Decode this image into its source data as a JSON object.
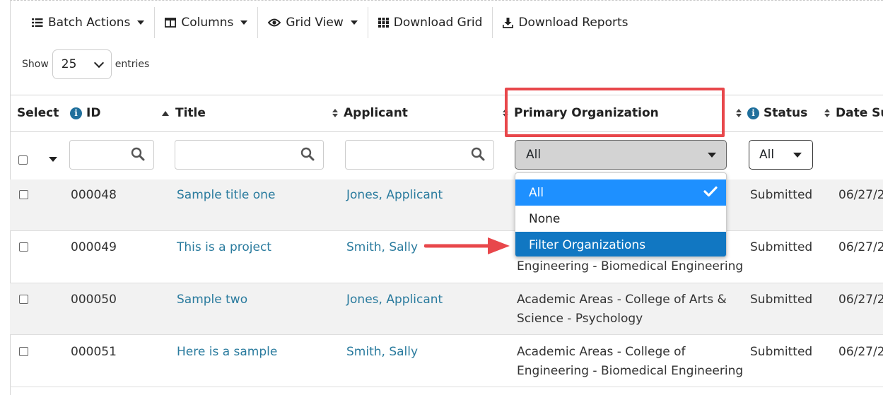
{
  "toolbar": {
    "batch_actions": "Batch Actions",
    "columns": "Columns",
    "grid_view": "Grid View",
    "download_grid": "Download Grid",
    "download_reports": "Download Reports"
  },
  "length": {
    "show": "Show",
    "value": "25",
    "entries": "entries"
  },
  "columns": {
    "select": "Select",
    "id": "ID",
    "title": "Title",
    "applicant": "Applicant",
    "primary_org": "Primary Organization",
    "status": "Status",
    "date_submitted": "Date Su"
  },
  "filters": {
    "org_value": "All",
    "status_value": "All"
  },
  "org_dropdown": {
    "options": [
      "All",
      "None",
      "Filter Organizations"
    ],
    "selected": "All",
    "highlighted": "Filter Organizations"
  },
  "rows": [
    {
      "id": "000048",
      "title": "Sample title one",
      "applicant": "Jones, Applicant",
      "org_line1": "",
      "org_line2": "",
      "status": "Submitted",
      "date": "06/27/2"
    },
    {
      "id": "000049",
      "title": "This is a project",
      "applicant": "Smith, Sally",
      "org_line1": "",
      "org_line2": "Engineering - Biomedical Engineering",
      "status": "Submitted",
      "date": "06/27/2"
    },
    {
      "id": "000050",
      "title": "Sample two",
      "applicant": "Jones, Applicant",
      "org_line1": "Academic Areas - College of Arts &",
      "org_line2": "Science - Psychology",
      "status": "Submitted",
      "date": "06/27/2"
    },
    {
      "id": "000051",
      "title": "Here is a sample",
      "applicant": "Smith, Sally",
      "org_line1": "Academic Areas - College of",
      "org_line2": "Engineering - Biomedical Engineering",
      "status": "Submitted",
      "date": "06/27/2"
    }
  ],
  "colors": {
    "link": "#2a7b9e",
    "info_icon": "#1f6f9c",
    "dropdown_selected": "#1e90ff",
    "dropdown_highlight": "#1177c2",
    "annotation_red": "#e8474b"
  }
}
